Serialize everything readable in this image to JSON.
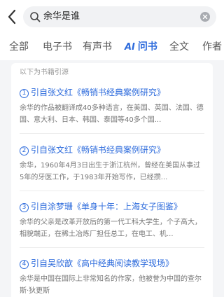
{
  "search": {
    "query": "余华是谁"
  },
  "tabs": [
    {
      "label": "全部"
    },
    {
      "label": "电子书"
    },
    {
      "label": "有声书"
    },
    {
      "label": "问书",
      "prefix": "AI"
    },
    {
      "label": "全文"
    },
    {
      "label": "作者"
    }
  ],
  "active_tab": "问书",
  "intro": "以下为书籍引源",
  "references": [
    {
      "num": "1",
      "title": "引自张文红《畅销书经典案例研究》",
      "excerpt": "余华的作品被翻译成40多种语言，在美国、英国、法国、德国、意大利、日本、韩国、泰国等40多个国..."
    },
    {
      "num": "2",
      "title": "引自张文红《畅销书经典案例研究》",
      "excerpt": "余华，1960年4月3日出生于浙江杭州，曾经在美国从事过5年的牙医工作，于1983年开始写作，已经攒..."
    },
    {
      "num": "3",
      "title": "引自涂梦珊《单身十年：上海女子图鉴》",
      "excerpt": "余华的父亲是改革开放后的第一代工科大学生，个子高大，相貌端正，在稀土冶炼厂担任总工，在电工、机..."
    },
    {
      "num": "4",
      "title": "引自吴欣歆《高中经典阅读教学现场》",
      "excerpt": "余华是中国在国际上非常知名的作家，他被誉为中国的查尔斯·狄更斯"
    }
  ],
  "colors": {
    "accent": "#2d6bdc",
    "background": "#f4f5f7"
  }
}
